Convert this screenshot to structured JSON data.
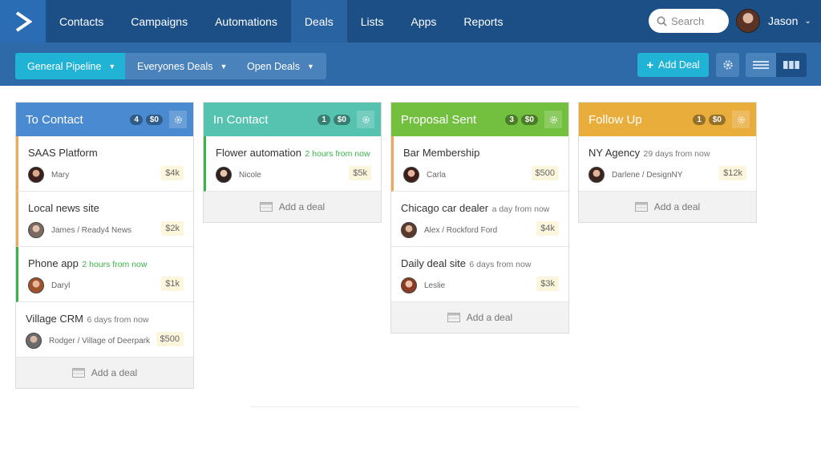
{
  "nav": {
    "items": [
      "Contacts",
      "Campaigns",
      "Automations",
      "Deals",
      "Lists",
      "Apps",
      "Reports"
    ],
    "active": "Deals",
    "search_placeholder": "Search",
    "user_name": "Jason"
  },
  "toolbar": {
    "pipeline": "General Pipeline",
    "owner_filter": "Everyones Deals",
    "status_filter": "Open Deals",
    "add_deal": "Add Deal"
  },
  "columns": [
    {
      "title": "To Contact",
      "count": "4",
      "total": "$0",
      "color": "#4a8ad0",
      "cards": [
        {
          "name": "SAAS Platform",
          "when": "",
          "contact": "Mary",
          "company": "",
          "amount": "$4k",
          "bar": "orange"
        },
        {
          "name": "Local news site",
          "when": "",
          "contact": "James",
          "company": "Ready4 News",
          "amount": "$2k",
          "bar": "orange"
        },
        {
          "name": "Phone app",
          "when": "2 hours from now",
          "contact": "Daryl",
          "company": "",
          "amount": "$1k",
          "bar": "green"
        },
        {
          "name": "Village CRM",
          "when": "6 days from now",
          "contact": "Rodger",
          "company": "Village of Deerpark",
          "amount": "$500",
          "bar": ""
        }
      ],
      "add_label": "Add a deal"
    },
    {
      "title": "In Contact",
      "count": "1",
      "total": "$0",
      "color": "#56c3b0",
      "cards": [
        {
          "name": "Flower automation",
          "when": "2 hours from now",
          "contact": "Nicole",
          "company": "",
          "amount": "$5k",
          "bar": "green"
        }
      ],
      "add_label": "Add a deal"
    },
    {
      "title": "Proposal Sent",
      "count": "3",
      "total": "$0",
      "color": "#73c040",
      "cards": [
        {
          "name": "Bar Membership",
          "when": "",
          "contact": "Carla",
          "company": "",
          "amount": "$500",
          "bar": "orange"
        },
        {
          "name": "Chicago car dealer",
          "when": "a day from now",
          "contact": "Alex",
          "company": "Rockford Ford",
          "amount": "$4k",
          "bar": ""
        },
        {
          "name": "Daily deal site",
          "when": "6 days from now",
          "contact": "Leslie",
          "company": "",
          "amount": "$3k",
          "bar": ""
        }
      ],
      "add_label": "Add a deal"
    },
    {
      "title": "Follow Up",
      "count": "1",
      "total": "$0",
      "color": "#e9ad3c",
      "cards": [
        {
          "name": "NY Agency",
          "when": "29 days from now",
          "contact": "Darlene",
          "company": "DesignNY",
          "amount": "$12k",
          "bar": ""
        }
      ],
      "add_label": "Add a deal"
    }
  ],
  "icons": {
    "logo": "arrow-logo-icon",
    "search": "search-icon",
    "settings": "gear-icon",
    "list_view": "list-view-icon",
    "column_view": "column-view-icon",
    "add_row": "card-add-icon"
  }
}
